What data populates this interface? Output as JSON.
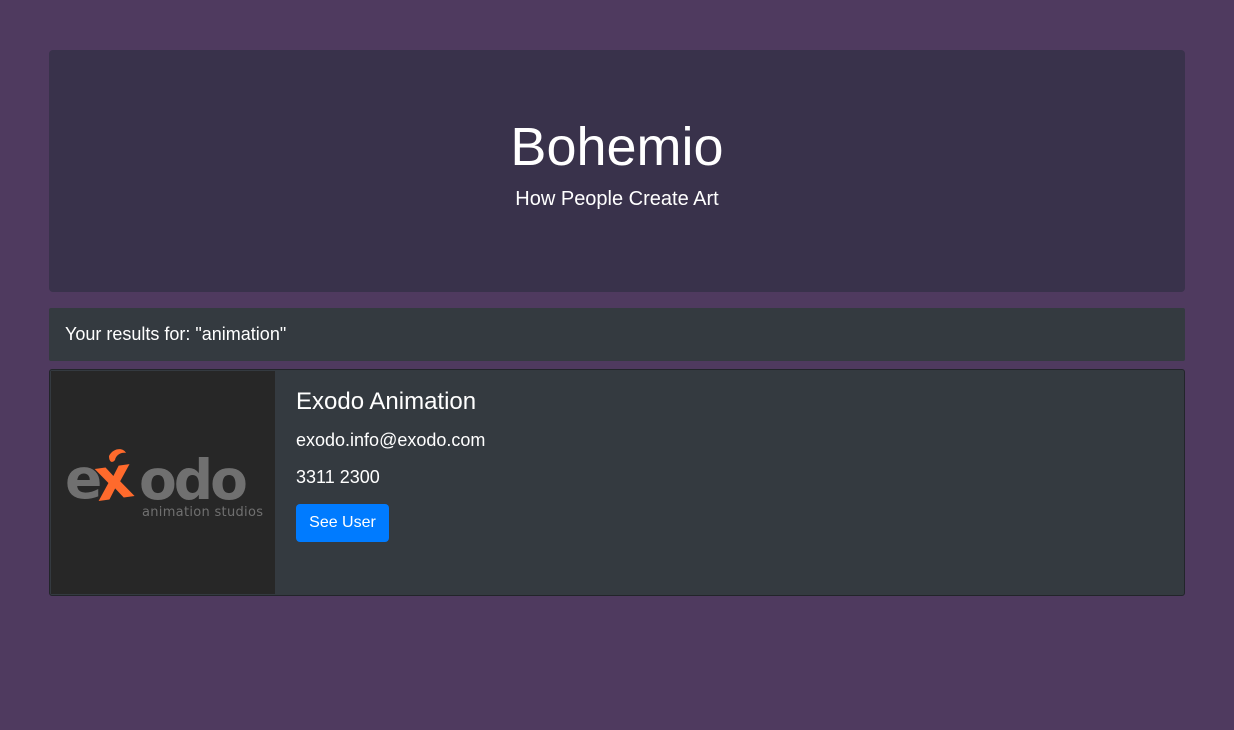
{
  "hero": {
    "title": "Bohemio",
    "subtitle": "How People Create Art"
  },
  "search": {
    "results_label": "Your results for: \"animation\""
  },
  "results": [
    {
      "name": "Exodo Animation",
      "email": "exodo.info@exodo.com",
      "phone": "3311 2300",
      "button_label": "See User",
      "logo": {
        "brand_text": "exodo",
        "tagline": "animation studios",
        "accent_color": "#ff6a2c",
        "text_color": "#707070"
      }
    }
  ],
  "colors": {
    "page_background": "#4f3a5f",
    "hero_background": "#39324b",
    "panel_background": "#343a40",
    "button_primary": "#007bff"
  }
}
